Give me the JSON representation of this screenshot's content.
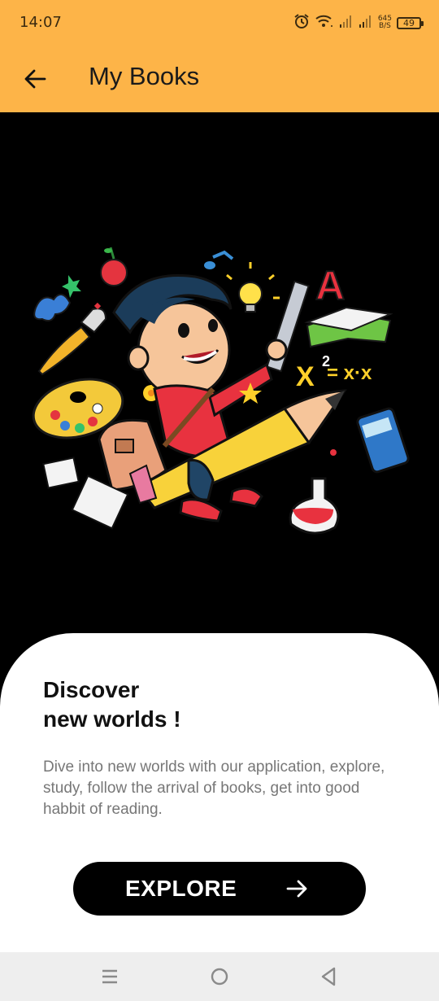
{
  "status": {
    "time": "14:07",
    "net_speed_value": "645",
    "net_speed_unit": "B/S",
    "battery": "49"
  },
  "header": {
    "title": "My Books"
  },
  "card": {
    "headline": "Discover\nnew worlds !",
    "description": "Dive into new worlds with our application, explore, study, follow the arrival of books, get into good habbit of reading.",
    "button_label": "EXPLORE"
  },
  "illustration": {
    "letter": "A",
    "formula_base": "X",
    "formula_exp": "2",
    "formula_rest": "= x·x"
  },
  "colors": {
    "accent": "#fdb448",
    "background": "#000000",
    "card": "#ffffff",
    "button": "#000000"
  }
}
